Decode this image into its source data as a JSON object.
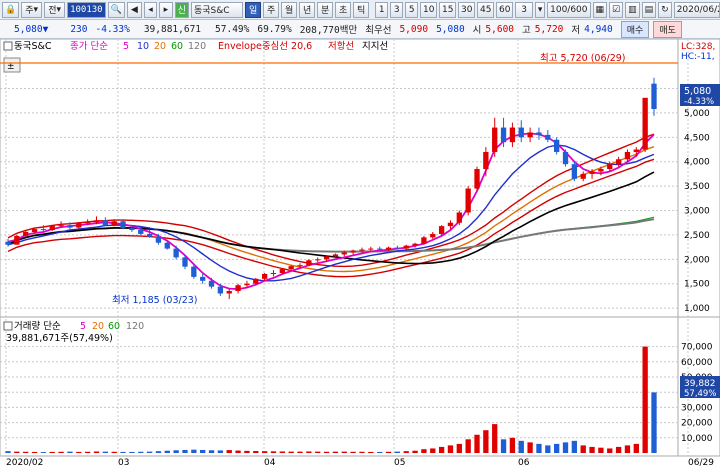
{
  "toolbar": {
    "lock_label": "🔒",
    "market_label": "주",
    "all_label": "전",
    "code": "100130",
    "stock_name": "동국S&C",
    "period_tabs": [
      "일",
      "주",
      "월",
      "년",
      "분",
      "초",
      "틱"
    ],
    "active_period": "일",
    "minutes": [
      "1",
      "3",
      "5",
      "10",
      "15",
      "30",
      "45",
      "60"
    ],
    "minute_sel": "3",
    "count": "100/600",
    "date": "2020/06/29"
  },
  "quote": {
    "price": "5,080▼",
    "change": "230",
    "change_pct": "-4.33%",
    "volume": "39,881,671",
    "vol_ratio": "57.49%",
    "turnover": "69.79%",
    "amount": "208,770백만",
    "best_ask_label": "최우선",
    "ask": "5,090",
    "bid": "5,080",
    "open_label": "시",
    "open": "5,600",
    "high_label": "고",
    "high": "5,720",
    "low_label": "저",
    "low": "4,940",
    "sell_label": "매수",
    "buy_label": "매도"
  },
  "colors": {
    "up": "#e00000",
    "down": "#1f5fd6",
    "ma5": "#e000c8",
    "ma10": "#1f2fcc",
    "ma20": "#e07000",
    "ma60": "#009900",
    "ma120": "#777777",
    "env": "#d40000",
    "resist": "#000000",
    "hline": "#ff6a00"
  },
  "price_panel": {
    "legend_name": "동국S&C",
    "ma_label": "종가 단순",
    "ma_periods": [
      "5",
      "10",
      "20",
      "60",
      "120"
    ],
    "envelope_label": "Envelope중심선 20,6",
    "resist_label": "저항선",
    "support_label": "지지선",
    "high_annot": "최고 5,720 (06/29)",
    "low_annot": "최저 1,185 (03/23)",
    "last_price": "5,080",
    "last_pct": "-4.33%",
    "lc_label": "LC:328,",
    "hc_label": "HC:-11,",
    "y_ticks": [
      "5,500",
      "5,000",
      "4,500",
      "4,000",
      "3,500",
      "3,000",
      "2,500",
      "2,000",
      "1,500",
      "1,000"
    ],
    "y_tick_values": [
      5500,
      5000,
      4500,
      4000,
      3500,
      3000,
      2500,
      2000,
      1500,
      1000
    ],
    "ylim": [
      900,
      5900
    ]
  },
  "volume_panel": {
    "legend_label": "거래량 단순",
    "ma_periods": [
      "5",
      "20",
      "60",
      "120"
    ],
    "info": "39,881,671주(57,49%)",
    "last_vol": "39,882",
    "last_pct": "57,49%",
    "y_ticks": [
      "70,000",
      "60,000",
      "50,000",
      "40,000",
      "30,000",
      "20,000",
      "10,000"
    ],
    "y_tick_values": [
      70000,
      60000,
      50000,
      40000,
      30000,
      20000,
      10000
    ],
    "ylim": [
      0,
      75000
    ]
  },
  "x_labels": [
    "2020/02",
    "03",
    "04",
    "05",
    "06",
    "06/29"
  ],
  "chart_data": {
    "type": "candlestick",
    "candles": [
      [
        2360,
        2420,
        2260,
        2300
      ],
      [
        2300,
        2500,
        2300,
        2480
      ],
      [
        2480,
        2600,
        2450,
        2560
      ],
      [
        2560,
        2650,
        2540,
        2620
      ],
      [
        2620,
        2700,
        2560,
        2600
      ],
      [
        2600,
        2700,
        2580,
        2690
      ],
      [
        2690,
        2780,
        2650,
        2700
      ],
      [
        2700,
        2760,
        2620,
        2650
      ],
      [
        2650,
        2760,
        2630,
        2740
      ],
      [
        2740,
        2820,
        2700,
        2760
      ],
      [
        2760,
        2880,
        2720,
        2800
      ],
      [
        2800,
        2860,
        2680,
        2700
      ],
      [
        2700,
        2820,
        2680,
        2780
      ],
      [
        2780,
        2800,
        2620,
        2640
      ],
      [
        2640,
        2700,
        2560,
        2600
      ],
      [
        2600,
        2640,
        2500,
        2520
      ],
      [
        2520,
        2600,
        2440,
        2460
      ],
      [
        2460,
        2520,
        2300,
        2340
      ],
      [
        2340,
        2400,
        2200,
        2220
      ],
      [
        2220,
        2280,
        2000,
        2040
      ],
      [
        2040,
        2100,
        1800,
        1850
      ],
      [
        1850,
        1900,
        1600,
        1640
      ],
      [
        1640,
        1700,
        1500,
        1560
      ],
      [
        1560,
        1620,
        1400,
        1440
      ],
      [
        1440,
        1500,
        1250,
        1300
      ],
      [
        1300,
        1400,
        1185,
        1350
      ],
      [
        1350,
        1500,
        1300,
        1470
      ],
      [
        1470,
        1560,
        1420,
        1500
      ],
      [
        1500,
        1620,
        1480,
        1600
      ],
      [
        1600,
        1720,
        1560,
        1700
      ],
      [
        1700,
        1780,
        1650,
        1720
      ],
      [
        1720,
        1820,
        1700,
        1800
      ],
      [
        1800,
        1880,
        1760,
        1860
      ],
      [
        1860,
        1920,
        1820,
        1880
      ],
      [
        1880,
        2000,
        1860,
        1980
      ],
      [
        1980,
        2040,
        1940,
        2000
      ],
      [
        2000,
        2080,
        1960,
        2060
      ],
      [
        2060,
        2120,
        2020,
        2100
      ],
      [
        2100,
        2180,
        2060,
        2140
      ],
      [
        2140,
        2200,
        2100,
        2180
      ],
      [
        2180,
        2240,
        2140,
        2200
      ],
      [
        2200,
        2260,
        2160,
        2220
      ],
      [
        2220,
        2260,
        2180,
        2200
      ],
      [
        2200,
        2260,
        2170,
        2240
      ],
      [
        2240,
        2280,
        2200,
        2220
      ],
      [
        2220,
        2300,
        2200,
        2280
      ],
      [
        2280,
        2340,
        2240,
        2320
      ],
      [
        2320,
        2480,
        2300,
        2450
      ],
      [
        2450,
        2560,
        2420,
        2520
      ],
      [
        2520,
        2700,
        2480,
        2680
      ],
      [
        2680,
        2800,
        2620,
        2750
      ],
      [
        2750,
        3000,
        2700,
        2960
      ],
      [
        2960,
        3500,
        2900,
        3450
      ],
      [
        3450,
        3900,
        3400,
        3850
      ],
      [
        3850,
        4300,
        3700,
        4200
      ],
      [
        4200,
        4900,
        4100,
        4700
      ],
      [
        4700,
        4900,
        4300,
        4400
      ],
      [
        4400,
        4800,
        4300,
        4700
      ],
      [
        4700,
        4850,
        4400,
        4500
      ],
      [
        4500,
        4700,
        4400,
        4600
      ],
      [
        4600,
        4700,
        4450,
        4550
      ],
      [
        4550,
        4650,
        4400,
        4450
      ],
      [
        4450,
        4500,
        4150,
        4200
      ],
      [
        4200,
        4250,
        3900,
        3950
      ],
      [
        3950,
        4000,
        3600,
        3650
      ],
      [
        3650,
        3800,
        3600,
        3750
      ],
      [
        3750,
        3850,
        3650,
        3800
      ],
      [
        3800,
        3900,
        3720,
        3850
      ],
      [
        3850,
        4000,
        3800,
        3950
      ],
      [
        3950,
        4100,
        3900,
        4050
      ],
      [
        4050,
        4250,
        4000,
        4200
      ],
      [
        4200,
        4300,
        4100,
        4250
      ],
      [
        4250,
        5300,
        4200,
        5310
      ],
      [
        5600,
        5720,
        4940,
        5080
      ]
    ],
    "volumes": [
      1200,
      900,
      800,
      700,
      600,
      700,
      800,
      900,
      700,
      800,
      1000,
      900,
      800,
      700,
      700,
      800,
      900,
      1200,
      1500,
      1800,
      2000,
      2200,
      2000,
      1800,
      1700,
      1900,
      1600,
      1400,
      1300,
      1200,
      1100,
      1000,
      900,
      900,
      1000,
      900,
      800,
      900,
      900,
      800,
      800,
      700,
      700,
      800,
      900,
      1200,
      1500,
      2500,
      3000,
      4000,
      5000,
      6000,
      9000,
      12000,
      15000,
      19000,
      9000,
      10000,
      8000,
      7000,
      6000,
      5000,
      6000,
      7000,
      8000,
      5000,
      4000,
      3500,
      3000,
      4000,
      5000,
      6000,
      70000,
      39882
    ],
    "title": "",
    "ylim": [
      900,
      5900
    ]
  },
  "ma_lines": {
    "ma5": [
      [
        2360,
        2400,
        2500,
        2540,
        2560,
        2620,
        2660,
        2680,
        2700,
        2720,
        2740,
        2760,
        2740,
        2720,
        2680,
        2620,
        2560,
        2480,
        2380,
        2240,
        2080,
        1900,
        1720,
        1580,
        1460,
        1400,
        1390,
        1420,
        1480,
        1560,
        1620,
        1700,
        1760,
        1820,
        1880,
        1920,
        1960,
        2000,
        2040,
        2080,
        2120,
        2160,
        2180,
        2200,
        2220,
        2240,
        2280,
        2320,
        2400,
        2480,
        2600,
        2780,
        3060,
        3400,
        3820,
        4250,
        4420,
        4520,
        4560,
        4580,
        4560,
        4500,
        4380,
        4200,
        4000,
        3850,
        3780,
        3760,
        3800,
        3880,
        4000,
        4120,
        4380,
        4560
      ]
    ],
    "ma10": [
      [
        2300,
        2340,
        2400,
        2440,
        2480,
        2520,
        2560,
        2600,
        2620,
        2640,
        2660,
        2690,
        2700,
        2700,
        2690,
        2670,
        2640,
        2600,
        2540,
        2460,
        2360,
        2240,
        2110,
        1980,
        1860,
        1760,
        1680,
        1620,
        1580,
        1560,
        1560,
        1580,
        1610,
        1660,
        1720,
        1780,
        1840,
        1900,
        1950,
        2000,
        2040,
        2080,
        2110,
        2140,
        2170,
        2190,
        2210,
        2240,
        2280,
        2340,
        2420,
        2520,
        2660,
        2840,
        3060,
        3320,
        3540,
        3750,
        3920,
        4080,
        4200,
        4300,
        4340,
        4320,
        4250,
        4150,
        4060,
        3990,
        3950,
        3940,
        3960,
        4000,
        4080,
        4150
      ]
    ]
  }
}
